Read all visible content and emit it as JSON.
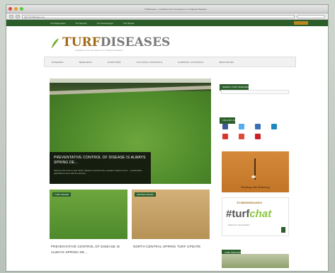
{
  "browser": {
    "title": "TurfDiseases - Guidelines from the Experts on Turfgrass Diseases",
    "url": "http://turfdiseases.org",
    "lights": [
      "#e0443e",
      "#dea123",
      "#5bc53b"
    ]
  },
  "topnav": {
    "items": [
      "Turf Diagnostics",
      "TD Network",
      "Turf Technologies",
      "Turf Weeds"
    ]
  },
  "logo": {
    "turf": "TURF",
    "diseases": "DISEASES",
    "tagline": "Guidelines from the Experts on Turfgrass Diseases"
  },
  "mainnav": {
    "items": [
      "DISEASES",
      "RESEARCH",
      "SYMPTOMS",
      "CULTURAL CONTROLS",
      "CHEMICAL CONTROLS",
      "RESOURCES"
    ]
  },
  "feature": {
    "title": "PREVENTATIVE CONTROL OF DISEASE IS ALWAYS SPRING DE...",
    "body": "Spring is the time of year where disease controls have a greater impact on turf ... preventative applications and cultural practices"
  },
  "cards": [
    {
      "tag": "TURF ISSUES",
      "title": "PREVENTATIVE CONTROL OF DISEASE IS ALWAYS SPRING DE..."
    },
    {
      "tag": "WINTER ISSUES",
      "title": "NORTH CENTRAL SPRING TURF UPDATE"
    }
  ],
  "sidebar": {
    "search_label": "SEARCH TURF DISEASES",
    "follow_label": "FOLLOW US",
    "podcast_label": "TURF PODCAST",
    "ad1_text": "Finding the Fairway",
    "ad2_mini": "TURFDISEASES",
    "ad2_hash": "#turf",
    "ad2_chat": "chat",
    "ad2_small": "follow the conversation",
    "social_icons": [
      {
        "name": "facebook-icon",
        "color": "#3b5998"
      },
      {
        "name": "twitter-icon",
        "color": "#55acee"
      },
      {
        "name": "flickr-icon",
        "color": "#3a6fb5"
      },
      {
        "name": "linkedin-icon",
        "color": "#1f86c1"
      },
      {
        "name": "youtube-icon",
        "color": "#d9352b"
      },
      {
        "name": "googleplus-icon",
        "color": "#dd4b39"
      },
      {
        "name": "pinterest-icon",
        "color": "#cb2027"
      }
    ]
  },
  "colors": {
    "brand_green": "#2b5e2a",
    "brand_orange": "#a06b1a"
  }
}
